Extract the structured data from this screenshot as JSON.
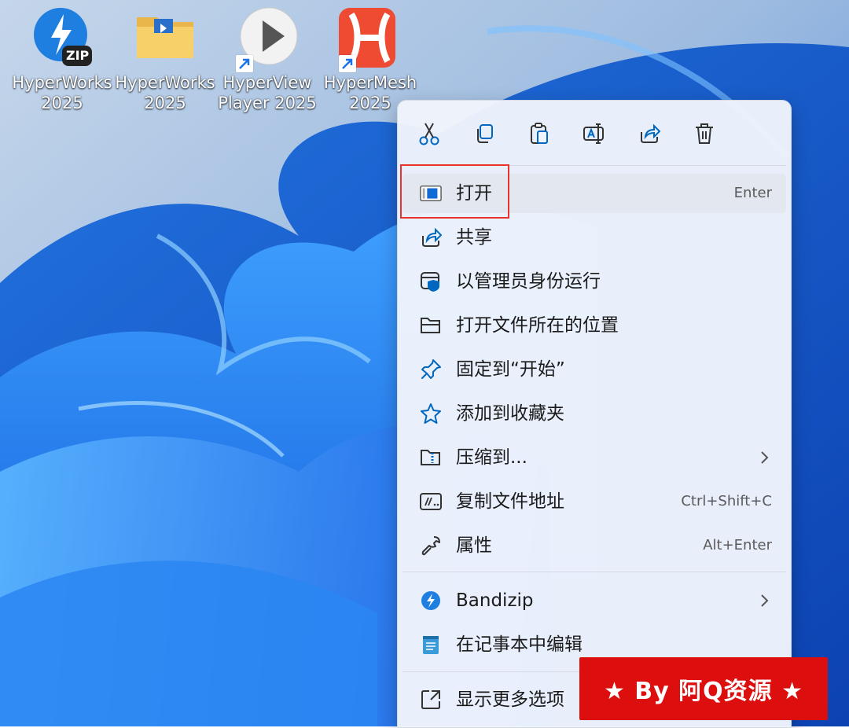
{
  "desktop": {
    "icons": [
      {
        "name": "HyperWorks 2025",
        "line1": "HyperWorks",
        "line2": "2025",
        "badge": "ZIP",
        "icon": "bandizip-zip-icon"
      },
      {
        "name": "HyperWorks 2025",
        "line1": "HyperWorks",
        "line2": "2025",
        "icon": "folder-icon"
      },
      {
        "name": "HyperView Player 2025",
        "line1": "HyperView",
        "line2": "Player 2025",
        "icon": "play-button-icon"
      },
      {
        "name": "HyperMesh 2025",
        "line1": "HyperMesh",
        "line2": "2025",
        "icon": "hypermesh-logo-icon"
      }
    ]
  },
  "context_menu": {
    "toolbar": [
      {
        "icon": "cut-icon",
        "action": "cut"
      },
      {
        "icon": "copy-icon",
        "action": "copy"
      },
      {
        "icon": "paste-icon",
        "action": "paste"
      },
      {
        "icon": "rename-icon",
        "action": "rename"
      },
      {
        "icon": "share-icon",
        "action": "share"
      },
      {
        "icon": "delete-icon",
        "action": "delete"
      }
    ],
    "items": [
      {
        "label": "打开",
        "shortcut": "Enter",
        "icon": "open-window-icon"
      },
      {
        "label": "共享",
        "icon": "share-icon"
      },
      {
        "label": "以管理员身份运行",
        "icon": "shield-icon"
      },
      {
        "label": "打开文件所在的位置",
        "icon": "folder-open-icon"
      },
      {
        "label": "固定到“开始”",
        "icon": "pin-icon"
      },
      {
        "label": "添加到收藏夹",
        "icon": "star-icon"
      },
      {
        "label": "压缩到...",
        "icon": "zip-folder-icon",
        "submenu": true
      },
      {
        "label": "复制文件地址",
        "shortcut": "Ctrl+Shift+C",
        "icon": "copy-path-icon"
      },
      {
        "label": "属性",
        "shortcut": "Alt+Enter",
        "icon": "wrench-icon"
      },
      {
        "label": "Bandizip",
        "icon": "bandizip-icon",
        "submenu": true
      },
      {
        "label": "在记事本中编辑",
        "icon": "notepad-icon"
      },
      {
        "label": "显示更多选项",
        "icon": "more-options-icon"
      }
    ]
  },
  "watermark": {
    "text": "★ By 阿Q资源 ★"
  },
  "colors": {
    "accent": "#0067c0",
    "highlight_border": "#e8332e",
    "watermark_bg": "#dc0e0e"
  }
}
